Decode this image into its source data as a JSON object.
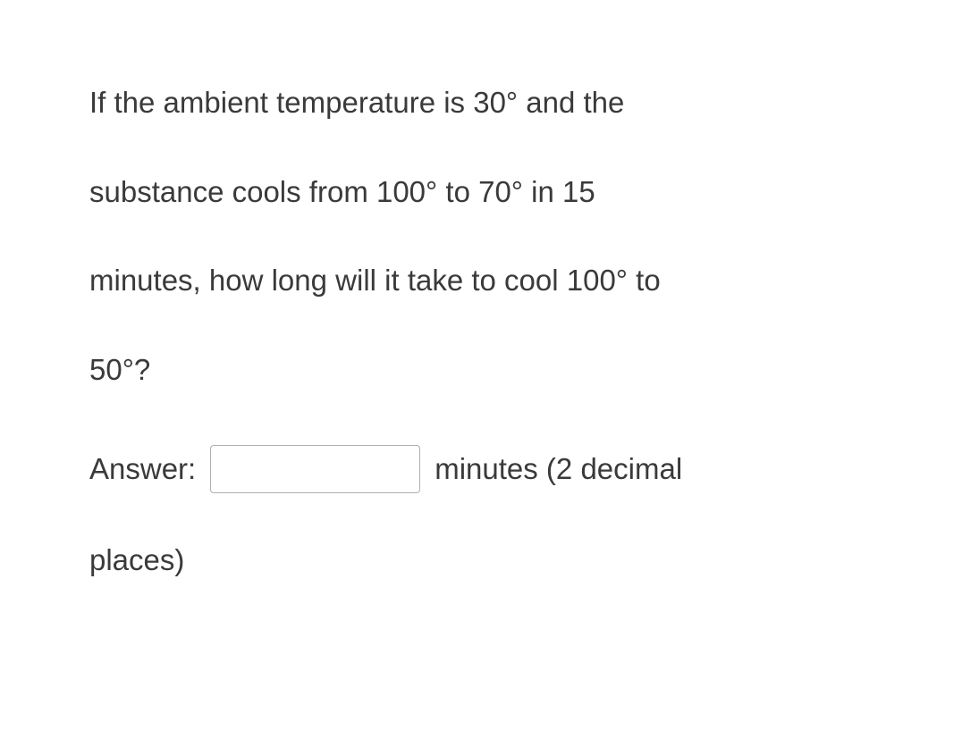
{
  "question": {
    "line1": "If the ambient temperature is 30° and the",
    "line2": "substance cools from 100° to 70° in 15",
    "line3": "minutes, how long will it take to cool 100° to",
    "line4": "50°?"
  },
  "answer": {
    "label": "Answer:",
    "input_value": "",
    "suffix1": "minutes (2 decimal",
    "suffix2": "places)"
  }
}
